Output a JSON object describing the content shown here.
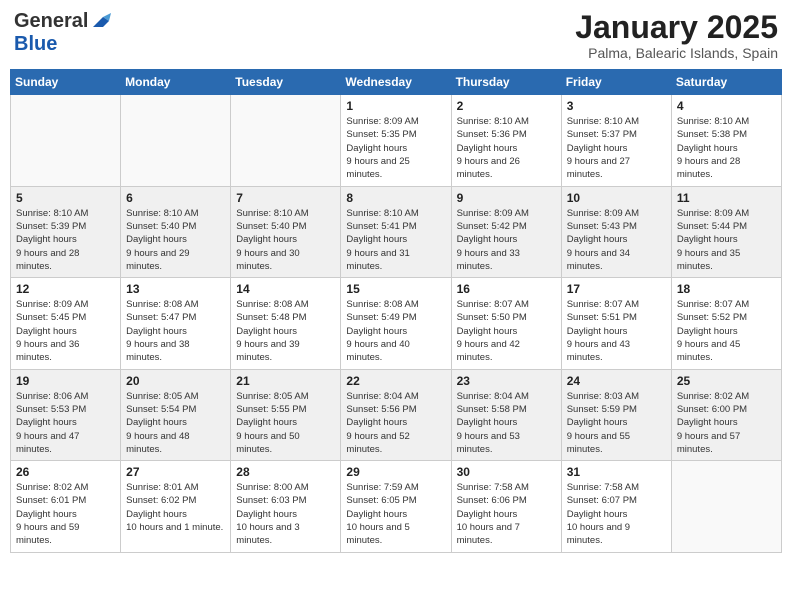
{
  "logo": {
    "general": "General",
    "blue": "Blue"
  },
  "title": "January 2025",
  "location": "Palma, Balearic Islands, Spain",
  "days_of_week": [
    "Sunday",
    "Monday",
    "Tuesday",
    "Wednesday",
    "Thursday",
    "Friday",
    "Saturday"
  ],
  "weeks": [
    [
      {
        "day": null
      },
      {
        "day": null
      },
      {
        "day": null
      },
      {
        "day": "1",
        "sunrise": "8:09 AM",
        "sunset": "5:35 PM",
        "daylight": "9 hours and 25 minutes."
      },
      {
        "day": "2",
        "sunrise": "8:10 AM",
        "sunset": "5:36 PM",
        "daylight": "9 hours and 26 minutes."
      },
      {
        "day": "3",
        "sunrise": "8:10 AM",
        "sunset": "5:37 PM",
        "daylight": "9 hours and 27 minutes."
      },
      {
        "day": "4",
        "sunrise": "8:10 AM",
        "sunset": "5:38 PM",
        "daylight": "9 hours and 28 minutes."
      }
    ],
    [
      {
        "day": "5",
        "sunrise": "8:10 AM",
        "sunset": "5:39 PM",
        "daylight": "9 hours and 28 minutes."
      },
      {
        "day": "6",
        "sunrise": "8:10 AM",
        "sunset": "5:40 PM",
        "daylight": "9 hours and 29 minutes."
      },
      {
        "day": "7",
        "sunrise": "8:10 AM",
        "sunset": "5:40 PM",
        "daylight": "9 hours and 30 minutes."
      },
      {
        "day": "8",
        "sunrise": "8:10 AM",
        "sunset": "5:41 PM",
        "daylight": "9 hours and 31 minutes."
      },
      {
        "day": "9",
        "sunrise": "8:09 AM",
        "sunset": "5:42 PM",
        "daylight": "9 hours and 33 minutes."
      },
      {
        "day": "10",
        "sunrise": "8:09 AM",
        "sunset": "5:43 PM",
        "daylight": "9 hours and 34 minutes."
      },
      {
        "day": "11",
        "sunrise": "8:09 AM",
        "sunset": "5:44 PM",
        "daylight": "9 hours and 35 minutes."
      }
    ],
    [
      {
        "day": "12",
        "sunrise": "8:09 AM",
        "sunset": "5:45 PM",
        "daylight": "9 hours and 36 minutes."
      },
      {
        "day": "13",
        "sunrise": "8:08 AM",
        "sunset": "5:47 PM",
        "daylight": "9 hours and 38 minutes."
      },
      {
        "day": "14",
        "sunrise": "8:08 AM",
        "sunset": "5:48 PM",
        "daylight": "9 hours and 39 minutes."
      },
      {
        "day": "15",
        "sunrise": "8:08 AM",
        "sunset": "5:49 PM",
        "daylight": "9 hours and 40 minutes."
      },
      {
        "day": "16",
        "sunrise": "8:07 AM",
        "sunset": "5:50 PM",
        "daylight": "9 hours and 42 minutes."
      },
      {
        "day": "17",
        "sunrise": "8:07 AM",
        "sunset": "5:51 PM",
        "daylight": "9 hours and 43 minutes."
      },
      {
        "day": "18",
        "sunrise": "8:07 AM",
        "sunset": "5:52 PM",
        "daylight": "9 hours and 45 minutes."
      }
    ],
    [
      {
        "day": "19",
        "sunrise": "8:06 AM",
        "sunset": "5:53 PM",
        "daylight": "9 hours and 47 minutes."
      },
      {
        "day": "20",
        "sunrise": "8:05 AM",
        "sunset": "5:54 PM",
        "daylight": "9 hours and 48 minutes."
      },
      {
        "day": "21",
        "sunrise": "8:05 AM",
        "sunset": "5:55 PM",
        "daylight": "9 hours and 50 minutes."
      },
      {
        "day": "22",
        "sunrise": "8:04 AM",
        "sunset": "5:56 PM",
        "daylight": "9 hours and 52 minutes."
      },
      {
        "day": "23",
        "sunrise": "8:04 AM",
        "sunset": "5:58 PM",
        "daylight": "9 hours and 53 minutes."
      },
      {
        "day": "24",
        "sunrise": "8:03 AM",
        "sunset": "5:59 PM",
        "daylight": "9 hours and 55 minutes."
      },
      {
        "day": "25",
        "sunrise": "8:02 AM",
        "sunset": "6:00 PM",
        "daylight": "9 hours and 57 minutes."
      }
    ],
    [
      {
        "day": "26",
        "sunrise": "8:02 AM",
        "sunset": "6:01 PM",
        "daylight": "9 hours and 59 minutes."
      },
      {
        "day": "27",
        "sunrise": "8:01 AM",
        "sunset": "6:02 PM",
        "daylight": "10 hours and 1 minute."
      },
      {
        "day": "28",
        "sunrise": "8:00 AM",
        "sunset": "6:03 PM",
        "daylight": "10 hours and 3 minutes."
      },
      {
        "day": "29",
        "sunrise": "7:59 AM",
        "sunset": "6:05 PM",
        "daylight": "10 hours and 5 minutes."
      },
      {
        "day": "30",
        "sunrise": "7:58 AM",
        "sunset": "6:06 PM",
        "daylight": "10 hours and 7 minutes."
      },
      {
        "day": "31",
        "sunrise": "7:58 AM",
        "sunset": "6:07 PM",
        "daylight": "10 hours and 9 minutes."
      },
      {
        "day": null
      }
    ]
  ],
  "labels": {
    "sunrise": "Sunrise:",
    "sunset": "Sunset:",
    "daylight": "Daylight hours"
  }
}
